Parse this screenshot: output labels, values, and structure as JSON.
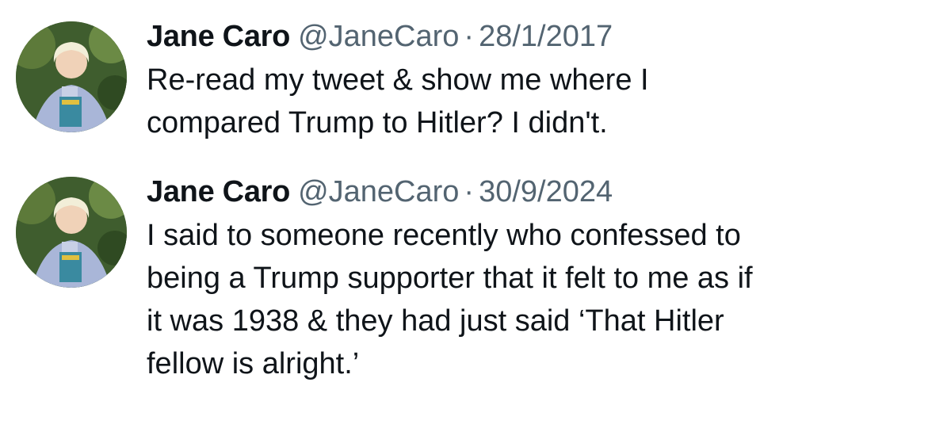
{
  "tweets": [
    {
      "author_name": "Jane Caro",
      "handle": "@JaneCaro",
      "separator": "·",
      "date": "28/1/2017",
      "text": "Re-read my tweet & show me where I\ncompared Trump to Hitler? I didn't.",
      "avatar_icon": "user-avatar-photo"
    },
    {
      "author_name": "Jane Caro",
      "handle": "@JaneCaro",
      "separator": "·",
      "date": "30/9/2024",
      "text": "I said to someone recently who confessed to\nbeing a Trump supporter that it felt to me as if\nit was 1938 & they had just said ‘That Hitler\nfellow is alright.’",
      "avatar_icon": "user-avatar-photo"
    }
  ],
  "colors": {
    "text_primary": "#0f1419",
    "text_secondary": "#536471",
    "background": "#ffffff"
  }
}
